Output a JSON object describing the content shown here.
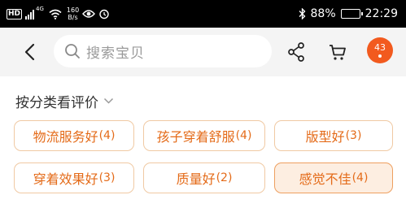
{
  "status_bar": {
    "hd": "HD",
    "net": "4G",
    "speed_value": "160",
    "speed_unit": "B/s",
    "battery": "88%",
    "time": "22:29",
    "battery_level": 0.88
  },
  "header": {
    "search_placeholder": "搜索宝贝",
    "more_badge": "43"
  },
  "filter": {
    "title": "按分类看评价",
    "tags": [
      {
        "label": "物流服务好",
        "count": "(4)",
        "active": false
      },
      {
        "label": "孩子穿着舒服",
        "count": "(4)",
        "active": false
      },
      {
        "label": "版型好",
        "count": "(3)",
        "active": false
      },
      {
        "label": "穿着效果好",
        "count": "(3)",
        "active": false
      },
      {
        "label": "质量好",
        "count": "(2)",
        "active": false
      },
      {
        "label": "感觉不佳",
        "count": "(4)",
        "active": true
      }
    ]
  },
  "colors": {
    "accent": "#e46b19",
    "badge": "#f25a1e",
    "tag_border": "#f0c9a3",
    "tag_active_bg": "#fdeee1"
  }
}
